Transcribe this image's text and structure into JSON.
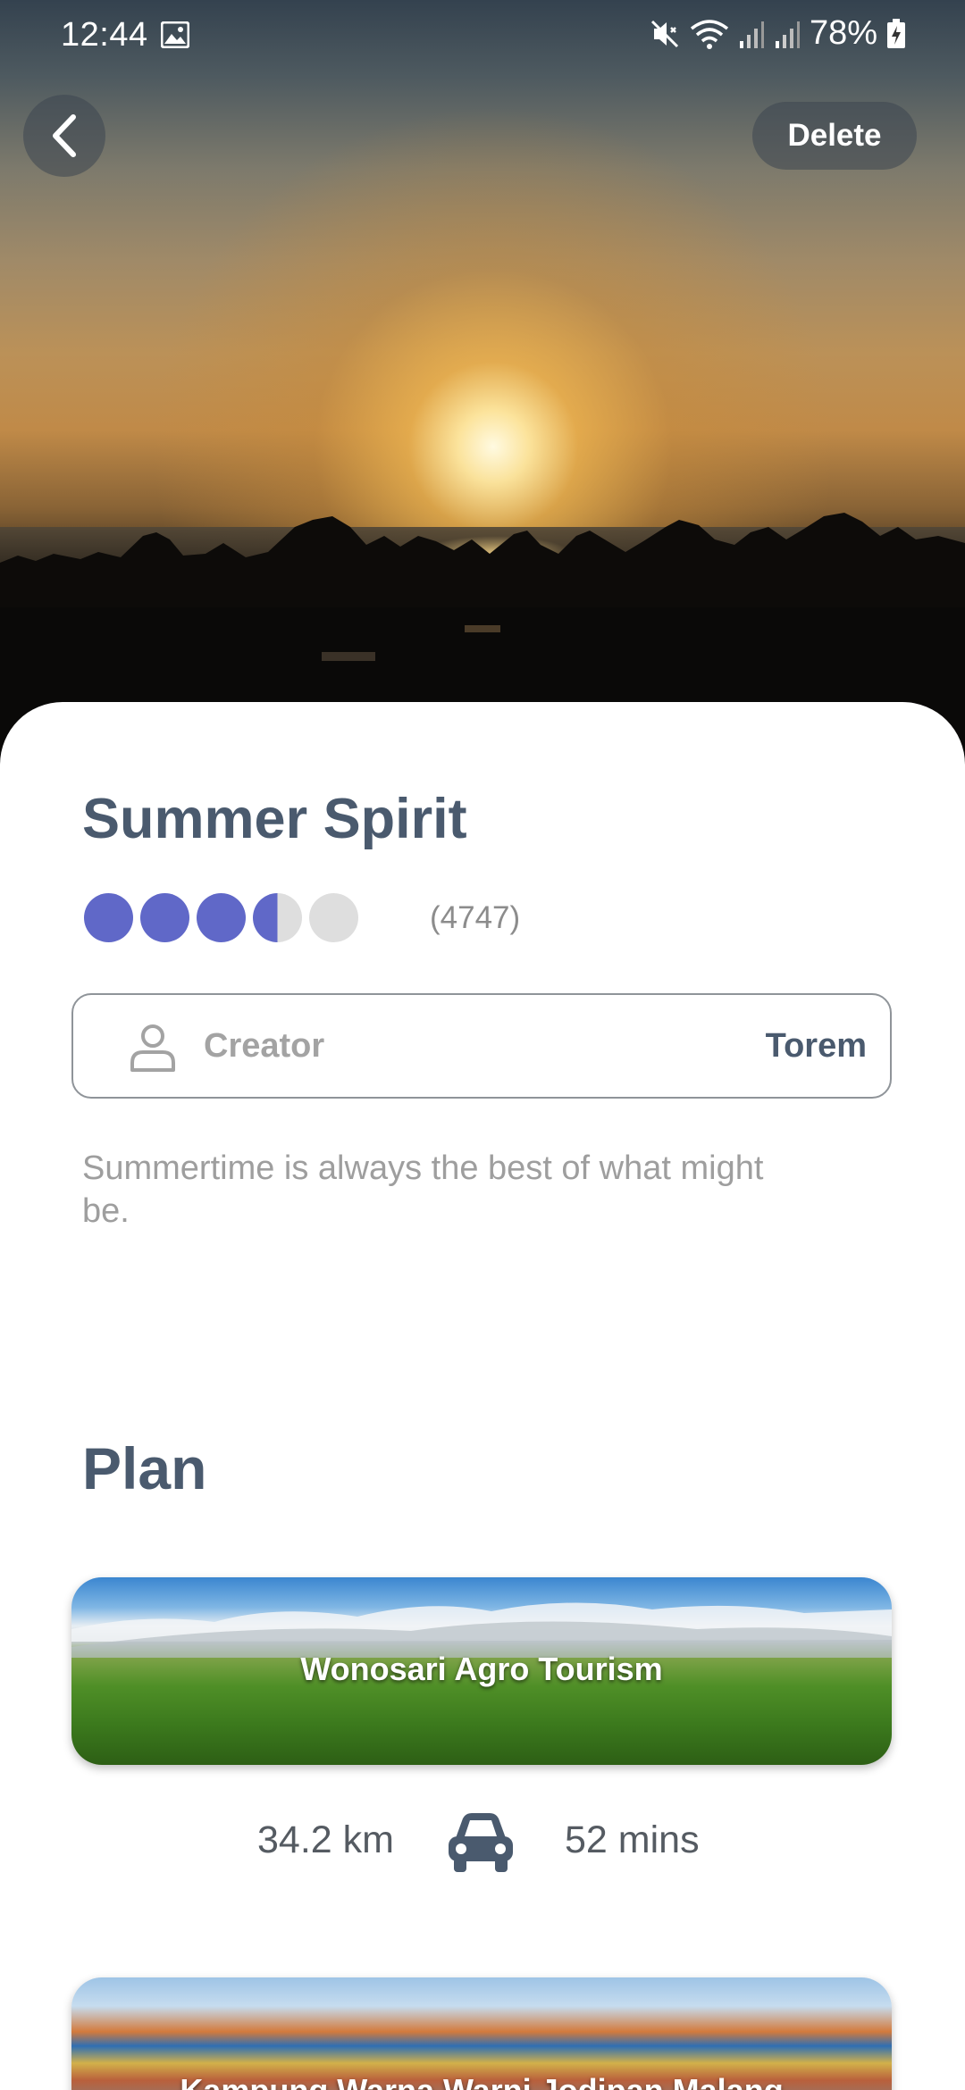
{
  "status_bar": {
    "time": "12:44",
    "battery": "78%"
  },
  "header": {
    "delete_label": "Delete"
  },
  "trip": {
    "title": "Summer Spirit",
    "rating": 3.5,
    "rating_max": 5,
    "rating_count": "(4747)",
    "creator_label": "Creator",
    "creator_name": "Torem",
    "description": "Summertime is always the best of what might be."
  },
  "plan": {
    "section_title": "Plan",
    "stops": [
      {
        "name": "Wonosari Agro Tourism"
      },
      {
        "name": "Kampung Warna Warni Jodipan Malang"
      }
    ],
    "legs": [
      {
        "distance": "34.2 km",
        "duration": "52 mins"
      }
    ]
  },
  "colors": {
    "accent": "#6068c8",
    "title": "#4a5a6e",
    "muted": "#9e9e9e"
  }
}
